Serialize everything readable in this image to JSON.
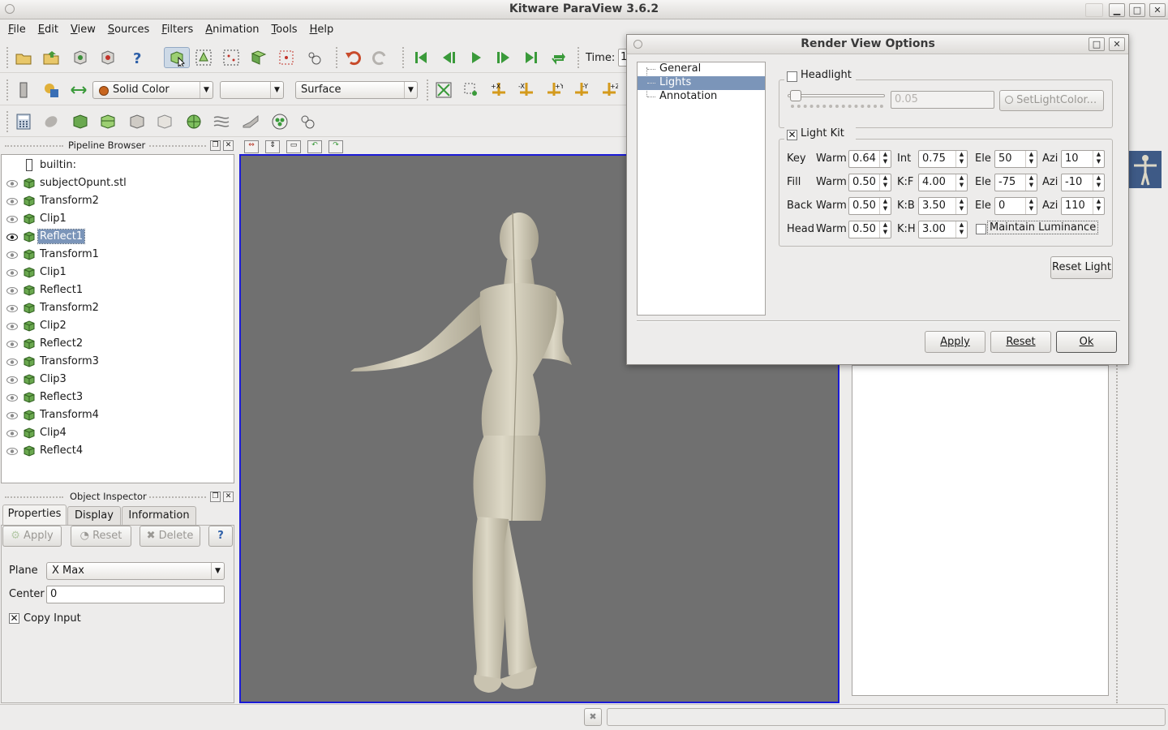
{
  "window": {
    "title": "Kitware ParaView 3.6.2"
  },
  "menu": [
    {
      "label": "File",
      "ul": "F",
      "rest": "ile"
    },
    {
      "label": "Edit",
      "ul": "E",
      "rest": "dit"
    },
    {
      "label": "View",
      "ul": "V",
      "rest": "iew"
    },
    {
      "label": "Sources",
      "ul": "S",
      "rest": "ources"
    },
    {
      "label": "Filters",
      "ul": "F",
      "rest": "ilters"
    },
    {
      "label": "Animation",
      "ul": "A",
      "rest": "nimation"
    },
    {
      "label": "Tools",
      "ul": "T",
      "rest": "ools"
    },
    {
      "label": "Help",
      "ul": "H",
      "rest": "elp"
    }
  ],
  "toolbar": {
    "time_label": "Time:",
    "time_value": "1",
    "color_by": "Solid Color",
    "component": "",
    "representation": "Surface",
    "camera_buttons": [
      "+X",
      "-X",
      "+Y",
      "-Y",
      "+Z",
      "-Z"
    ]
  },
  "pipeline_browser": {
    "title": "Pipeline Browser",
    "root": "builtin:",
    "items": [
      {
        "label": "subjectOpunt.stl",
        "selected": false
      },
      {
        "label": "Transform2",
        "selected": false
      },
      {
        "label": "Clip1",
        "selected": false
      },
      {
        "label": "Reflect1",
        "selected": true
      },
      {
        "label": "Transform1",
        "selected": false
      },
      {
        "label": "Clip1",
        "selected": false
      },
      {
        "label": "Reflect1",
        "selected": false
      },
      {
        "label": "Transform2",
        "selected": false
      },
      {
        "label": "Clip2",
        "selected": false
      },
      {
        "label": "Reflect2",
        "selected": false
      },
      {
        "label": "Transform3",
        "selected": false
      },
      {
        "label": "Clip3",
        "selected": false
      },
      {
        "label": "Reflect3",
        "selected": false
      },
      {
        "label": "Transform4",
        "selected": false
      },
      {
        "label": "Clip4",
        "selected": false
      },
      {
        "label": "Reflect4",
        "selected": false
      }
    ]
  },
  "object_inspector": {
    "title": "Object Inspector",
    "tabs": [
      "Properties",
      "Display",
      "Information"
    ],
    "active_tab": "Properties",
    "buttons": {
      "apply": "Apply",
      "reset": "Reset",
      "delete": "Delete",
      "help": "?"
    },
    "plane_label": "Plane",
    "plane_value": "X Max",
    "center_label": "Center",
    "center_value": "0",
    "copy_input_label": "Copy Input",
    "copy_input_checked": true
  },
  "dialog": {
    "title": "Render View Options",
    "tree": [
      "General",
      "Lights",
      "Annotation"
    ],
    "selected": "Lights",
    "headlight": {
      "label": "Headlight",
      "checked": false,
      "intensity": "0.05",
      "color_button": "SetLightColor..."
    },
    "light_kit": {
      "label": "Light Kit",
      "checked": true,
      "rows": [
        {
          "name": "Key",
          "warm": "0.64",
          "second_label": "Int",
          "second_value": "0.75",
          "ele": "50",
          "azi": "10"
        },
        {
          "name": "Fill",
          "warm": "0.50",
          "second_label": "K:F",
          "second_value": "4.00",
          "ele": "-75",
          "azi": "-10"
        },
        {
          "name": "Back",
          "warm": "0.50",
          "second_label": "K:B",
          "second_value": "3.50",
          "ele": "0",
          "azi": "110"
        },
        {
          "name": "Head",
          "warm": "0.50",
          "second_label": "K:H",
          "second_value": "3.00"
        }
      ],
      "warm_label": "Warm",
      "ele_label": "Ele",
      "azi_label": "Azi",
      "maintain_luminance": "Maintain Luminance"
    },
    "reset_light": "Reset Light",
    "buttons": {
      "apply": "Apply",
      "reset": "Reset",
      "ok": "Ok"
    }
  },
  "colors": {
    "render_background": "#707070",
    "render_border": "#1b1bd6",
    "selection": "#7b95b9",
    "model": "#d8d3c2"
  }
}
